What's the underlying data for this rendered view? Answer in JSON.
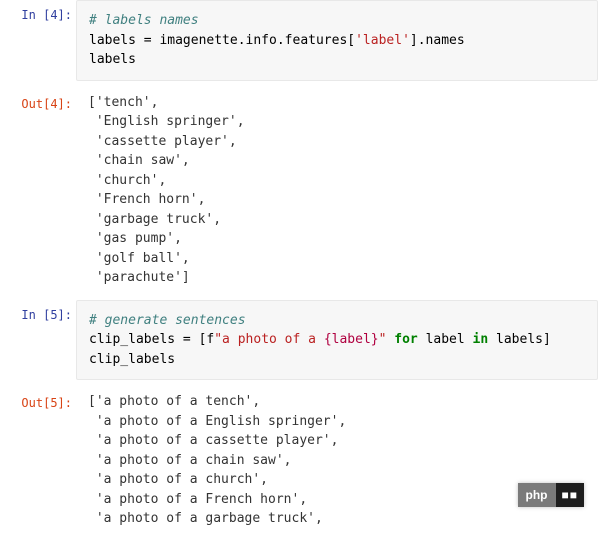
{
  "cells": {
    "in4": {
      "prompt": "In [4]:",
      "comment": "# labels names",
      "line2_a": "labels = imagenette.info.features[",
      "line2_str": "'label'",
      "line2_b": "].names",
      "line3": "labels"
    },
    "out4": {
      "prompt": "Out[4]:",
      "text": "['tench',\n 'English springer',\n 'cassette player',\n 'chain saw',\n 'church',\n 'French horn',\n 'garbage truck',\n 'gas pump',\n 'golf ball',\n 'parachute']"
    },
    "in5": {
      "prompt": "In [5]:",
      "comment": "# generate sentences",
      "line2_a": "clip_labels = [f",
      "line2_str1": "\"a photo of a ",
      "line2_interp": "{label}",
      "line2_str2": "\"",
      "line2_b": " ",
      "line2_for": "for",
      "line2_c": " label ",
      "line2_in": "in",
      "line2_d": " labels]",
      "line3": "clip_labels"
    },
    "out5": {
      "prompt": "Out[5]:",
      "text": "['a photo of a tench',\n 'a photo of a English springer',\n 'a photo of a cassette player',\n 'a photo of a chain saw',\n 'a photo of a church',\n 'a photo of a French horn',\n 'a photo of a garbage truck',"
    }
  },
  "watermark": {
    "left": "php",
    "right": "■■"
  }
}
